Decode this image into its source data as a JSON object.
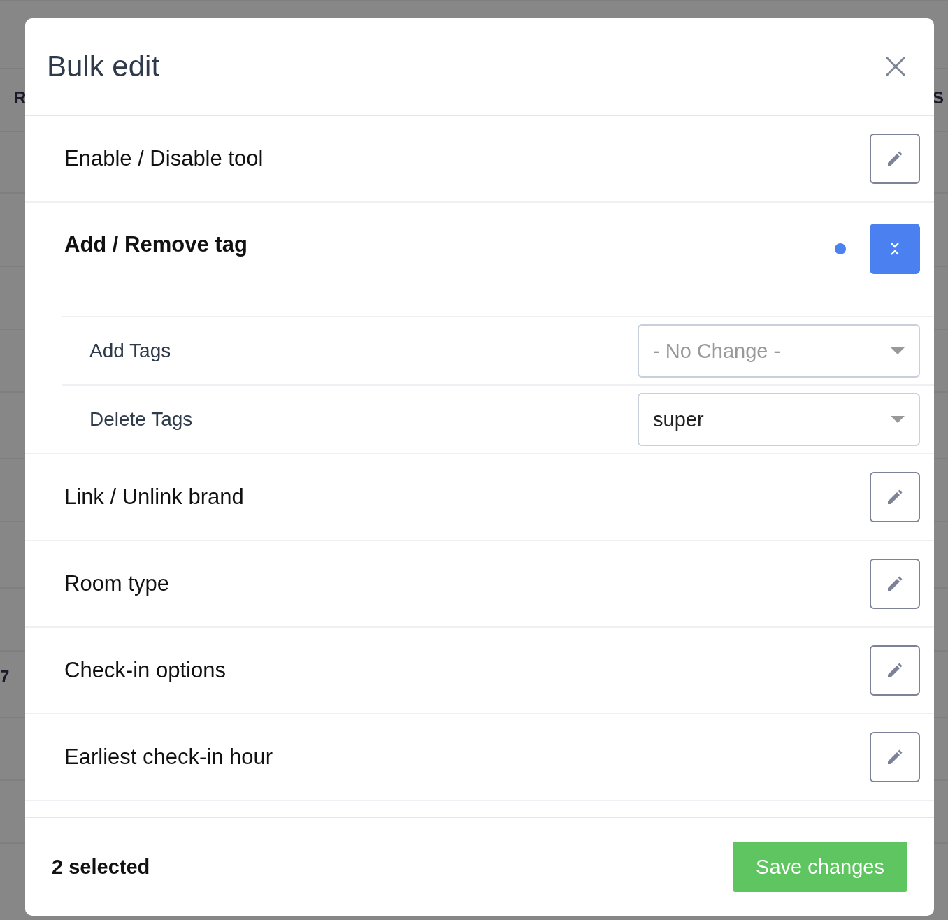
{
  "backdrop": {
    "texts": [
      "R",
      "S",
      "7"
    ]
  },
  "dialog": {
    "title": "Bulk edit",
    "sections": [
      {
        "title": "Enable / Disable tool",
        "expanded": false,
        "modified": false
      },
      {
        "title": "Add / Remove tag",
        "expanded": true,
        "modified": true,
        "fields": [
          {
            "label": "Add Tags",
            "placeholder": "- No Change -"
          },
          {
            "label": "Delete Tags",
            "value": "super"
          }
        ]
      },
      {
        "title": "Link / Unlink brand",
        "expanded": false,
        "modified": false
      },
      {
        "title": "Room type",
        "expanded": false,
        "modified": false
      },
      {
        "title": "Check-in options",
        "expanded": false,
        "modified": false
      },
      {
        "title": "Earliest check-in hour",
        "expanded": false,
        "modified": false
      }
    ],
    "footer": {
      "count": "2 selected",
      "save_button": "Save changes"
    }
  }
}
